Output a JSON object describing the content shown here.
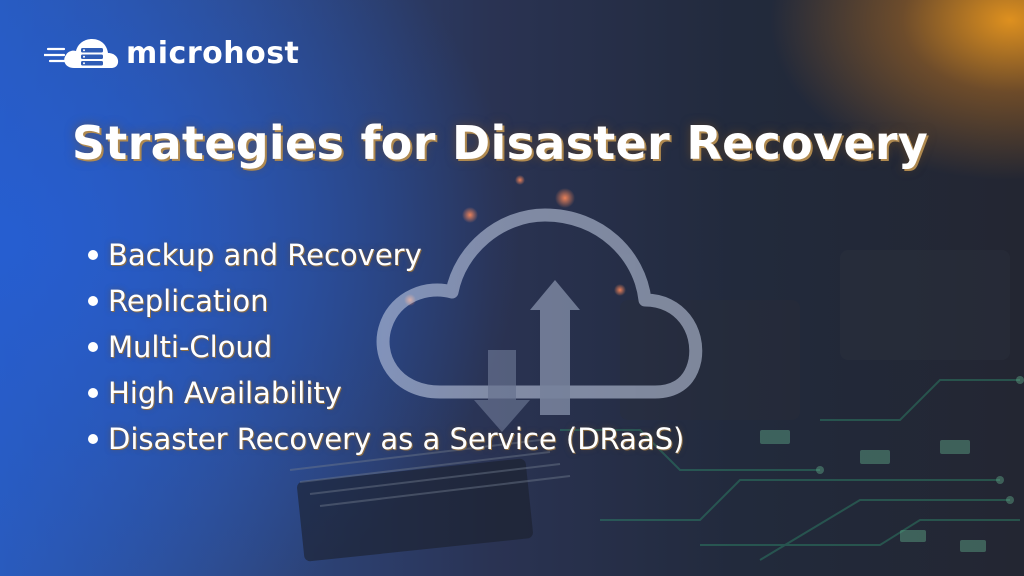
{
  "brand": {
    "name": "microhost",
    "logo_icon": "server-cloud-icon"
  },
  "title": "Strategies for Disaster Recovery",
  "bullets": [
    "Backup and Recovery",
    "Replication",
    "Multi-Cloud",
    "High Availability",
    "Disaster Recovery as a Service (DRaaS)"
  ],
  "background": {
    "illustration": "cloud-upload-download-icon",
    "scene": "circuit-board"
  },
  "colors": {
    "left_glow": "#2a5ab8",
    "right_glow": "#e8961e",
    "text": "#ffffff",
    "title_shadow": "#b08a50"
  }
}
